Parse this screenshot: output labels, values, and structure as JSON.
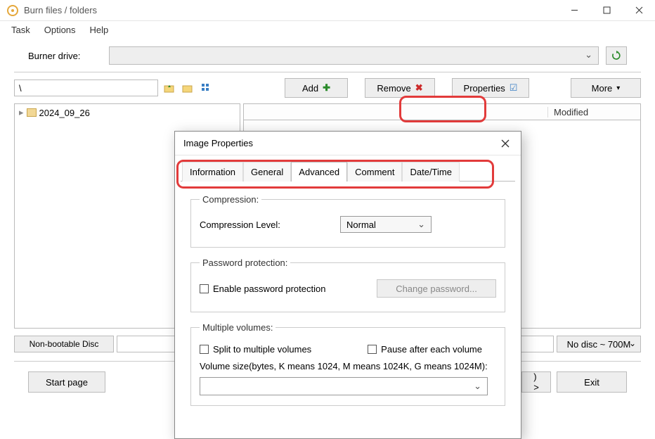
{
  "window": {
    "title": "Burn files / folders",
    "menu": {
      "task": "Task",
      "options": "Options",
      "help": "Help"
    }
  },
  "burner": {
    "label": "Burner drive:"
  },
  "toolbar": {
    "path": "\\",
    "add": "Add",
    "remove": "Remove",
    "properties": "Properties",
    "more": "More"
  },
  "tree": {
    "root": "2024_09_26"
  },
  "list": {
    "col_modified": "Modified"
  },
  "status": {
    "boot": "Non-bootable Disc",
    "disc": "No disc ~ 700M"
  },
  "buttons": {
    "start": "Start page",
    "angle": ") >",
    "exit": "Exit"
  },
  "dialog": {
    "title": "Image Properties",
    "tabs": {
      "information": "Information",
      "general": "General",
      "advanced": "Advanced",
      "comment": "Comment",
      "datetime": "Date/Time"
    },
    "compression": {
      "legend": "Compression:",
      "level_label": "Compression Level:",
      "level_value": "Normal"
    },
    "password": {
      "legend": "Password protection:",
      "enable": "Enable password protection",
      "change": "Change password..."
    },
    "volumes": {
      "legend": "Multiple volumes:",
      "split": "Split to multiple volumes",
      "pause": "Pause after each volume",
      "size_label": "Volume size(bytes, K means 1024, M means 1024K, G means 1024M):"
    }
  }
}
